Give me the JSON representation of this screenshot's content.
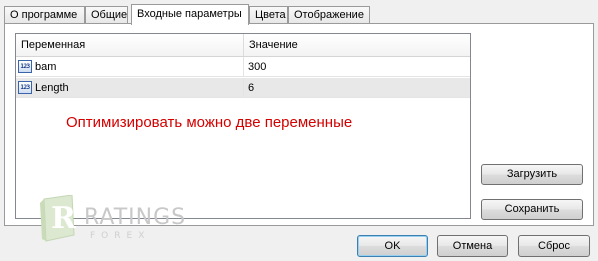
{
  "tabs": [
    {
      "label": "О программе",
      "active": false
    },
    {
      "label": "Общие",
      "active": false
    },
    {
      "label": "Входные параметры",
      "active": true
    },
    {
      "label": "Цвета",
      "active": false
    },
    {
      "label": "Отображение",
      "active": false
    }
  ],
  "params_table": {
    "headers": {
      "variable": "Переменная",
      "value": "Значение"
    },
    "rows": [
      {
        "icon": "integer-param-icon",
        "icon_text": "123",
        "name": "bam",
        "value": "300"
      },
      {
        "icon": "integer-param-icon",
        "icon_text": "123",
        "name": "Length",
        "value": "6"
      }
    ]
  },
  "annotation": {
    "text": "Оптимизировать можно две переменные",
    "color": "#d40000"
  },
  "side_buttons": {
    "load_label": "Загрузить",
    "save_label": "Сохранить"
  },
  "dialog_buttons": {
    "ok_label": "OK",
    "cancel_label": "Отмена",
    "reset_label": "Сброс"
  },
  "watermark": {
    "logo_letter": "R",
    "brand": "RATINGS",
    "sub": "FOREX"
  },
  "colors": {
    "annotation_red": "#d40000",
    "selected_row": "#e8e8e8",
    "ok_border": "#3c7fb1"
  }
}
